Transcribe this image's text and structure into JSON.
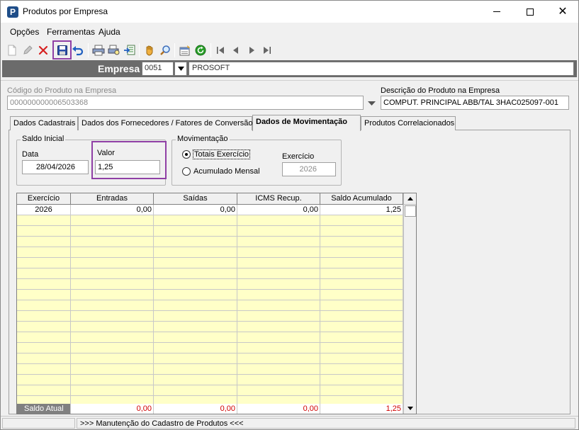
{
  "window": {
    "title": "Produtos por Empresa",
    "app_icon_letter": "P"
  },
  "menu": {
    "items": [
      "Opções",
      "Ferramentas",
      "Ajuda"
    ]
  },
  "toolbar": {
    "icons": [
      "new-document-icon",
      "edit-pencil-icon",
      "delete-x-icon",
      "save-disk-icon",
      "undo-icon",
      "print-icon",
      "print-preview-icon",
      "export-icon",
      "hand-icon",
      "search-magnifier-icon",
      "properties-icon",
      "refresh-icon",
      "first-record-icon",
      "previous-record-icon",
      "next-record-icon",
      "last-record-icon"
    ],
    "accent_highlight": "#8f3fa5"
  },
  "empresa": {
    "label": "Empresa",
    "code": "0051",
    "name": "PROSOFT"
  },
  "produto": {
    "codigo_label": "Código do Produto na Empresa",
    "codigo_value": "000000000006503368",
    "descricao_label": "Descrição do Produto na Empresa",
    "descricao_value": "COMPUT. PRINCIPAL ABB/TAL 3HAC025097-001"
  },
  "tabs": [
    {
      "label": "Dados Cadastrais",
      "active": false
    },
    {
      "label": "Dados dos Fornecedores / Fatores de Conversão",
      "active": false
    },
    {
      "label": "Dados de Movimentação",
      "active": true
    },
    {
      "label": "Produtos Correlacionados",
      "active": false
    }
  ],
  "saldo_inicial": {
    "title": "Saldo Inicial",
    "data_label": "Data",
    "data_value": "28/04/2026",
    "valor_label": "Valor",
    "valor_value": "1,25"
  },
  "movimentacao": {
    "title": "Movimentação",
    "option_totais": "Totais Exercício",
    "option_acumulado": "Acumulado Mensal",
    "selected": "totais",
    "exercicio_label": "Exercício",
    "exercicio_value": "2026"
  },
  "grid": {
    "columns": [
      "Exercício",
      "Entradas",
      "Saídas",
      "ICMS Recup.",
      "Saldo Acumulado"
    ],
    "rows": [
      [
        "2026",
        "0,00",
        "0,00",
        "0,00",
        "1,25"
      ]
    ],
    "empty_rows": 18,
    "footer_label": "Saldo Atual",
    "footer_values": [
      "0,00",
      "0,00",
      "0,00",
      "1,25"
    ],
    "row_color": "#ffffc8",
    "footer_value_color": "#d00000"
  },
  "status": {
    "message": ">>> Manutenção do Cadastro de Produtos <<<"
  }
}
